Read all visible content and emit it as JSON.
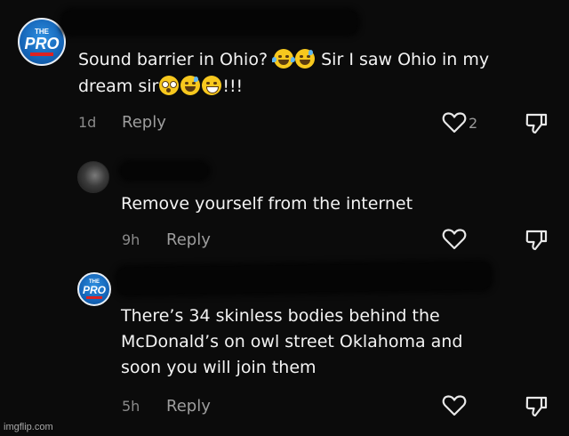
{
  "comments": [
    {
      "author_redacted": true,
      "text_part1": "Sound barrier in Ohio?",
      "text_part2": "Sir I saw Ohio in my",
      "text_part3": "dream sir",
      "text_suffix": "!!!",
      "age": "1d",
      "reply_label": "Reply",
      "like_count": "2",
      "avatar": {
        "top_text": "THE",
        "main_text": "PRO"
      }
    },
    {
      "author_redacted": true,
      "text": "Remove yourself from the internet",
      "age": "9h",
      "reply_label": "Reply"
    },
    {
      "author_redacted": true,
      "text_lines": [
        "There’s 34 skinless bodies behind the",
        "McDonald’s on owl street Oklahoma and",
        "soon you will join them"
      ],
      "age": "5h",
      "reply_label": "Reply",
      "avatar": {
        "top_text": "THE",
        "main_text": "PRO"
      }
    }
  ],
  "watermark": "imgflip.com",
  "colors": {
    "background": "#0b0b0b",
    "text": "#f3f3f3",
    "meta": "#8a8a8a",
    "avatar_blue": "#1565b8"
  },
  "icons": [
    "heart-icon",
    "dislike-icon",
    "emoji-joy",
    "emoji-sweat-smile",
    "emoji-flushed",
    "emoji-grin"
  ]
}
